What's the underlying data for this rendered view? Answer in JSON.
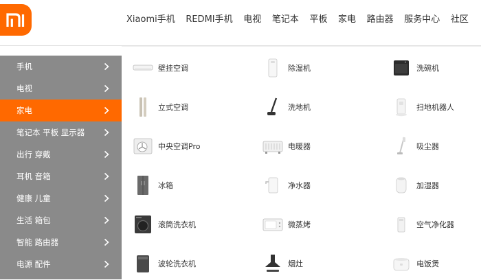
{
  "brand": {
    "logo_text": "mi",
    "accent_color": "#ff6900"
  },
  "nav": {
    "items": [
      "Xiaomi手机",
      "REDMI手机",
      "电视",
      "笔记本",
      "平板",
      "家电",
      "路由器",
      "服务中心",
      "社区"
    ]
  },
  "sidebar": {
    "active_index": 2,
    "active_color": "#ff6900",
    "background_color": "#8a8a8a",
    "items": [
      {
        "label": "手机"
      },
      {
        "label": "电视"
      },
      {
        "label": "家电"
      },
      {
        "label": "笔记本 平板 显示器"
      },
      {
        "label": "出行 穿戴"
      },
      {
        "label": "耳机 音箱"
      },
      {
        "label": "健康 儿童"
      },
      {
        "label": "生活 箱包"
      },
      {
        "label": "智能 路由器"
      },
      {
        "label": "电源 配件"
      }
    ]
  },
  "products": {
    "rows": [
      [
        {
          "label": "壁挂空调",
          "icon": "wall-ac-icon"
        },
        {
          "label": "除湿机",
          "icon": "dehumidifier-icon"
        },
        {
          "label": "洗碗机",
          "icon": "dishwasher-icon"
        }
      ],
      [
        {
          "label": "立式空调",
          "icon": "standing-ac-icon"
        },
        {
          "label": "洗地机",
          "icon": "floor-washer-icon"
        },
        {
          "label": "扫地机器人",
          "icon": "robot-vacuum-icon"
        }
      ],
      [
        {
          "label": "中央空调Pro",
          "icon": "central-ac-icon"
        },
        {
          "label": "电暖器",
          "icon": "heater-icon"
        },
        {
          "label": "吸尘器",
          "icon": "vacuum-cleaner-icon"
        }
      ],
      [
        {
          "label": "冰箱",
          "icon": "fridge-icon"
        },
        {
          "label": "净水器",
          "icon": "water-purifier-icon"
        },
        {
          "label": "加湿器",
          "icon": "humidifier-icon"
        }
      ],
      [
        {
          "label": "滚筒洗衣机",
          "icon": "front-load-washer-icon"
        },
        {
          "label": "微蒸烤",
          "icon": "steam-oven-icon"
        },
        {
          "label": "空气净化器",
          "icon": "air-purifier-icon"
        }
      ],
      [
        {
          "label": "波轮洗衣机",
          "icon": "top-load-washer-icon"
        },
        {
          "label": "烟灶",
          "icon": "range-hood-icon"
        },
        {
          "label": "电饭煲",
          "icon": "rice-cooker-icon"
        }
      ]
    ]
  }
}
